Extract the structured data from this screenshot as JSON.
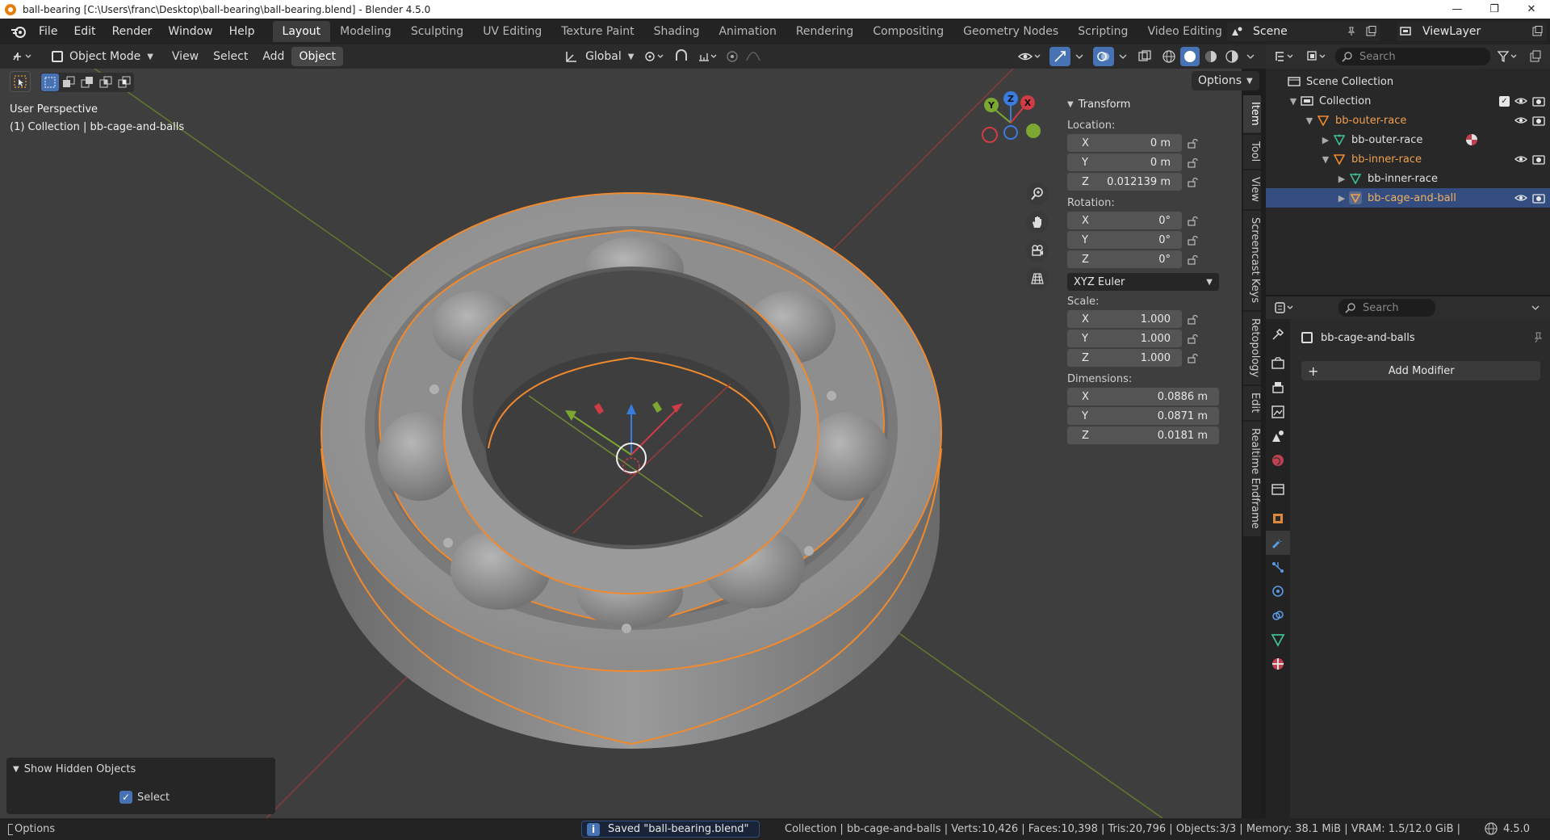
{
  "window": {
    "title": "ball-bearing [C:\\Users\\franc\\Desktop\\ball-bearing\\ball-bearing.blend] - Blender 4.5.0",
    "controls": {
      "minimize": "—",
      "maximize": "❐",
      "close": "✕"
    }
  },
  "menus": [
    "File",
    "Edit",
    "Render",
    "Window",
    "Help"
  ],
  "workspaces": [
    "Layout",
    "Modeling",
    "Sculpting",
    "UV Editing",
    "Texture Paint",
    "Shading",
    "Animation",
    "Rendering",
    "Compositing",
    "Geometry Nodes",
    "Scripting",
    "Video Editing"
  ],
  "workspace_add": "+",
  "scene": {
    "name": "Scene",
    "view_layer": "ViewLayer"
  },
  "viewport_header": {
    "mode": "Object Mode",
    "menus": [
      "View",
      "Select",
      "Add",
      "Object"
    ],
    "transform_orientation": "Global"
  },
  "viewport": {
    "perspective_label": "User Perspective",
    "collection_label": "(1) Collection | bb-cage-and-balls",
    "options_label": "Options",
    "gizmo_axes": {
      "x": "X",
      "y": "Y",
      "z": "Z"
    }
  },
  "npanel": {
    "section_title": "Transform",
    "location_label": "Location:",
    "location": {
      "x": "0 m",
      "y": "0 m",
      "z": "0.012139 m"
    },
    "rotation_label": "Rotation:",
    "rotation": {
      "x": "0°",
      "y": "0°",
      "z": "0°"
    },
    "rotation_mode": "XYZ Euler",
    "scale_label": "Scale:",
    "scale": {
      "x": "1.000",
      "y": "1.000",
      "z": "1.000"
    },
    "dimensions_label": "Dimensions:",
    "dimensions": {
      "x": "0.0886 m",
      "y": "0.0871 m",
      "z": "0.0181 m"
    },
    "axis_labels": {
      "x": "X",
      "y": "Y",
      "z": "Z"
    }
  },
  "side_tabs": [
    "Item",
    "Tool",
    "View",
    "Screencast Keys",
    "Retopology",
    "Edit",
    "Realtime Endframe"
  ],
  "last_operator": {
    "title": "Show Hidden Objects",
    "checkbox_label": "Select",
    "checked": true
  },
  "outliner": {
    "search_placeholder": "Search",
    "root": "Scene Collection",
    "items": [
      {
        "label": "Collection"
      },
      {
        "label": "bb-outer-race"
      },
      {
        "label": "bb-outer-race"
      },
      {
        "label": "bb-inner-race"
      },
      {
        "label": "bb-inner-race"
      },
      {
        "label": "bb-cage-and-ball"
      }
    ]
  },
  "properties": {
    "search_placeholder": "Search",
    "object_name": "bb-cage-and-balls",
    "add_modifier_label": "Add Modifier",
    "add_modifier_plus": "+"
  },
  "statusbar": {
    "options": "Options",
    "message": "Saved \"ball-bearing.blend\"",
    "stats": "Collection | bb-cage-and-balls | Verts:10,426 | Faces:10,398 | Tris:20,796 | Objects:3/3 | Memory: 38.1 MiB | VRAM: 1.5/12.0 GiB |",
    "version": "4.5.0"
  },
  "colors": {
    "selection_outline": "#f08a2e",
    "active_object_text": "#f0a050",
    "outliner_selection": "#334d80",
    "axis_x": "#d03c46",
    "axis_y": "#7ca832",
    "axis_z": "#3a7be0",
    "active_tab": "#3d3d3d"
  }
}
